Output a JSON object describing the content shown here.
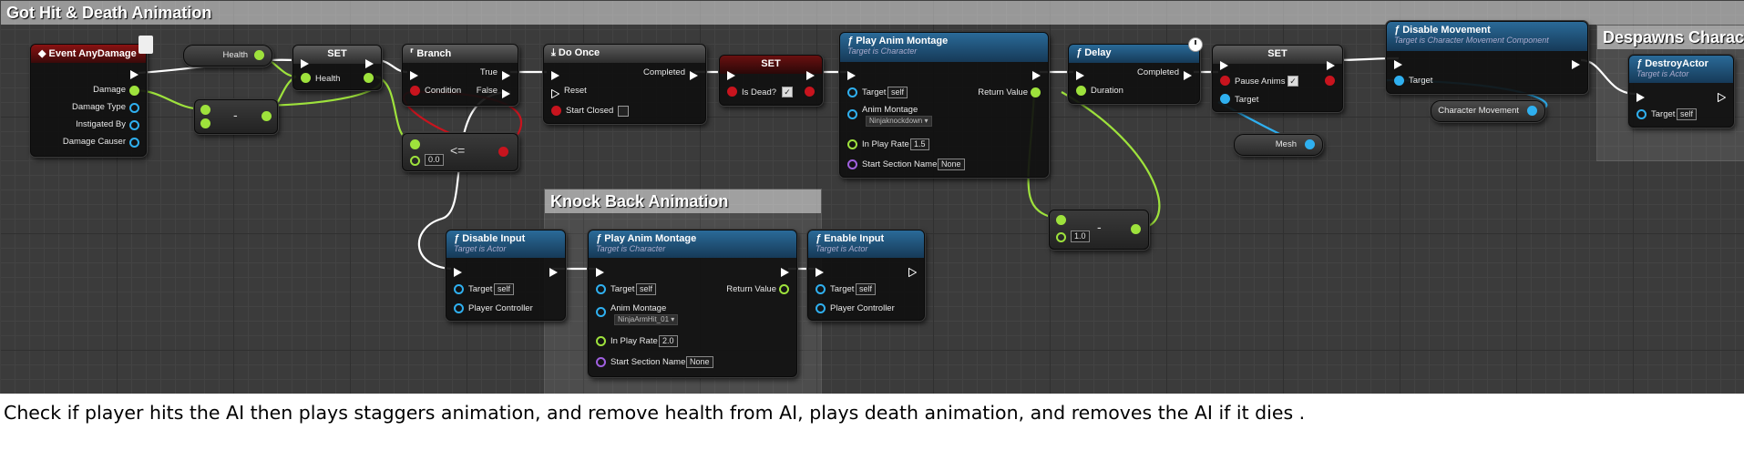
{
  "comments": {
    "main": "Got Hit & Death Animation",
    "knockback": "Knock Back Animation",
    "despawn": "Despawns Character"
  },
  "nodes": {
    "event_any_damage": {
      "title": "Event AnyDamage",
      "pins": [
        "Damage",
        "Damage Type",
        "Instigated By",
        "Damage Causer"
      ]
    },
    "get_health": {
      "label": "Health"
    },
    "set_health": {
      "title": "SET",
      "pin": "Health"
    },
    "subtract": {
      "op": "-"
    },
    "branch": {
      "title": "Branch",
      "condition": "Condition",
      "true": "True",
      "false": "False"
    },
    "lte": {
      "op": "<=",
      "value": "0.0"
    },
    "do_once": {
      "title": "Do Once",
      "completed": "Completed",
      "reset": "Reset",
      "start_closed": "Start Closed"
    },
    "set_is_dead": {
      "title": "SET",
      "pin": "Is Dead?",
      "checked": "✓"
    },
    "play_montage_death": {
      "title": "Play Anim Montage",
      "subtitle": "Target is Character",
      "target": "Target",
      "self": "self",
      "return_value": "Return Value",
      "anim_montage": "Anim Montage",
      "montage_value": "Ninjaknockdown",
      "play_rate": "In Play Rate",
      "play_rate_value": "1.5",
      "start_section": "Start Section Name",
      "start_section_value": "None"
    },
    "delay": {
      "title": "Delay",
      "completed": "Completed",
      "duration": "Duration"
    },
    "minus_one": {
      "op": "-",
      "value": "1.0"
    },
    "set_pause": {
      "title": "SET",
      "pause": "Pause Anims",
      "checked": "✓",
      "target": "Target"
    },
    "mesh": {
      "label": "Mesh"
    },
    "disable_movement": {
      "title": "Disable Movement",
      "subtitle": "Target is Character Movement Component",
      "target": "Target"
    },
    "character_movement": {
      "label": "Character Movement"
    },
    "destroy_actor": {
      "title": "DestroyActor",
      "subtitle": "Target is Actor",
      "target": "Target",
      "self": "self"
    },
    "disable_input": {
      "title": "Disable Input",
      "subtitle": "Target is Actor",
      "target": "Target",
      "self": "self",
      "controller": "Player Controller"
    },
    "play_montage_kb": {
      "title": "Play Anim Montage",
      "subtitle": "Target is Character",
      "target": "Target",
      "self": "self",
      "return_value": "Return Value",
      "anim_montage": "Anim Montage",
      "montage_value": "NinjaArmHit_01",
      "play_rate": "In Play Rate",
      "play_rate_value": "2.0",
      "start_section": "Start Section Name",
      "start_section_value": "None"
    },
    "enable_input": {
      "title": "Enable Input",
      "subtitle": "Target is Actor",
      "target": "Target",
      "self": "self",
      "controller": "Player Controller"
    }
  },
  "caption": "Check if player hits the AI then plays staggers animation, and remove health from AI, plays death animation, and removes the AI if it dies .",
  "colors": {
    "exec": "#ffffff",
    "float": "#9ee23c",
    "object": "#2fb0f0",
    "bool": "#c8141e",
    "name": "#a060e0",
    "event_header": "#8a1212",
    "function_header": "#2a6a98"
  }
}
